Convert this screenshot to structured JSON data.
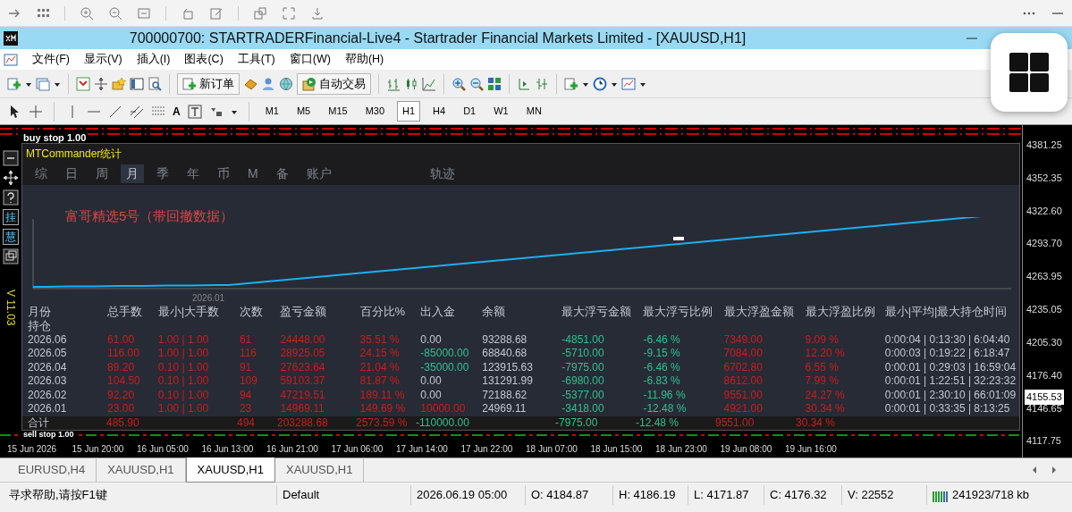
{
  "window": {
    "title": "700000700: STARTRADERFinancial-Live4 - Startrader Financial Markets Limited - [XAUUSD,H1]"
  },
  "menu": [
    "文件(F)",
    "显示(V)",
    "插入(I)",
    "图表(C)",
    "工具(T)",
    "窗口(W)",
    "帮助(H)"
  ],
  "toolbar": {
    "new_order": "新订单",
    "auto_trading": "自动交易"
  },
  "drawing_tools": {
    "text_tool": "A"
  },
  "timeframes": [
    {
      "label": "M1",
      "selected": false
    },
    {
      "label": "M5",
      "selected": false
    },
    {
      "label": "M15",
      "selected": false
    },
    {
      "label": "M30",
      "selected": false
    },
    {
      "label": "H1",
      "selected": true
    },
    {
      "label": "H4",
      "selected": false
    },
    {
      "label": "D1",
      "selected": false
    },
    {
      "label": "W1",
      "selected": false
    },
    {
      "label": "MN",
      "selected": false
    }
  ],
  "chart": {
    "top_order": "buy stop 1.00",
    "bottom_order": "sell stop 1.00",
    "version": "V 11.03",
    "side_buttons": [
      "挂",
      "慧"
    ],
    "price_axis": [
      "4381.25",
      "4352.35",
      "4322.60",
      "4293.70",
      "4263.95",
      "4235.05",
      "4205.30",
      "4176.40",
      "4146.65",
      "4117.75"
    ],
    "current_price": "4155.53",
    "time_axis": [
      "15 Jun 2026",
      "15 Jun 20:00",
      "16 Jun 05:00",
      "16 Jun 13:00",
      "16 Jun 21:00",
      "17 Jun 06:00",
      "17 Jun 14:00",
      "17 Jun 22:00",
      "18 Jun 07:00",
      "18 Jun 15:00",
      "18 Jun 23:00",
      "19 Jun 08:00",
      "19 Jun 16:00"
    ]
  },
  "panel": {
    "title": "MTCommander统计",
    "tabs": [
      {
        "label": "综",
        "selected": false
      },
      {
        "label": "日",
        "selected": false
      },
      {
        "label": "周",
        "selected": false
      },
      {
        "label": "月",
        "selected": true
      },
      {
        "label": "季",
        "selected": false
      },
      {
        "label": "年",
        "selected": false
      },
      {
        "label": "币",
        "selected": false
      },
      {
        "label": "M",
        "selected": false
      },
      {
        "label": "备",
        "selected": false
      },
      {
        "label": "账户",
        "selected": false
      },
      {
        "label": "轨迹",
        "selected": false
      }
    ],
    "curve_label": "富哥精选5号（带回撤数据）",
    "curve_date": "2026.01",
    "columns": [
      {
        "label": "月份",
        "sublabel": "持仓",
        "color": "#c3c8d1"
      },
      {
        "label": "总手数",
        "color": "#d11b1b"
      },
      {
        "label": "最小|大手数",
        "color": "#d11b1b"
      },
      {
        "label": "次数",
        "color": "#d11b1b"
      },
      {
        "label": "盈亏金额",
        "color": "#d11b1b"
      },
      {
        "label": "百分比%",
        "color": "#d11b1b"
      },
      {
        "label": "出入金"
      },
      {
        "label": "余额",
        "color": "#c3c8d1"
      },
      {
        "label": "最大浮亏金额",
        "color": "#2fc08f"
      },
      {
        "label": "最大浮亏比例",
        "color": "#2fc08f"
      },
      {
        "label": "最大浮盈金额",
        "color": "#d11b1b"
      },
      {
        "label": "最大浮盈比例",
        "color": "#d11b1b"
      },
      {
        "label": "最小|平均|最大持仓时间",
        "color": "#c3c8d1"
      }
    ],
    "rows": [
      {
        "cells": [
          "2026.06",
          "61.00",
          "1.00 | 1.00",
          "61",
          "24448.00",
          "35.51 %",
          {
            "text": "0.00",
            "color": "#c3c8d1"
          },
          "93288.68",
          "-4851.00",
          "-6.46 %",
          "7349.00",
          "9.09 %",
          "0:00:04 | 0:13:30 | 6:04:40"
        ]
      },
      {
        "cells": [
          "2026.05",
          "116.00",
          "1.00 | 1.00",
          "116",
          "28925.05",
          "24.15 %",
          {
            "text": "-85000.00",
            "color": "#2fc08f"
          },
          "68840.68",
          "-5710.00",
          "-9.15 %",
          "7084.00",
          "12.20 %",
          "0:00:03 | 0:19:22 | 6:18:47"
        ]
      },
      {
        "cells": [
          "2026.04",
          "89.20",
          "0.10 | 1.00",
          "91",
          "27623.64",
          "21.04 %",
          {
            "text": "-35000.00",
            "color": "#2fc08f"
          },
          "123915.63",
          "-7975.00",
          "-6.46 %",
          "6702.80",
          "6.55 %",
          "0:00:01 | 0:29:03 | 16:59:04"
        ]
      },
      {
        "cells": [
          "2026.03",
          "104.50",
          "0.10 | 1.00",
          "109",
          "59103.37",
          "81.87 %",
          {
            "text": "0.00",
            "color": "#c3c8d1"
          },
          "131291.99",
          "-6980.00",
          "-6.83 %",
          "8612.00",
          "7.99 %",
          "0:00:01 | 1:22:51 | 32:23:32"
        ]
      },
      {
        "cells": [
          "2026.02",
          "92.20",
          "0.10 | 1.00",
          "94",
          "47219.51",
          "189.11 %",
          {
            "text": "0.00",
            "color": "#c3c8d1"
          },
          "72188.62",
          "-5377.00",
          "-11.96 %",
          "9551.00",
          "24.27 %",
          "0:00:01 | 2:30:10 | 66:01:09"
        ]
      },
      {
        "cells": [
          "2026.01",
          "23.00",
          "1.00 | 1.00",
          "23",
          "14969.11",
          "149.69 %",
          {
            "text": "10000.00",
            "color": "#d11b1b"
          },
          "24969.11",
          "-3418.00",
          "-12.48 %",
          "4921.00",
          "30.34 %",
          "0:00:01 | 0:33:35 | 8:13:25"
        ]
      }
    ],
    "total": {
      "cells": [
        "合计",
        "485.90",
        null,
        "494",
        "203288.68",
        "2573.59 %",
        {
          "text": "-110000.00",
          "color": "#2fc08f"
        },
        null,
        "-7975.00",
        "-12.48 %",
        "9551.00",
        "30.34 %",
        null
      ]
    }
  },
  "chart_tabs": [
    {
      "label": "EURUSD,H4",
      "selected": false
    },
    {
      "label": "XAUUSD,H1",
      "selected": false
    },
    {
      "label": "XAUUSD,H1",
      "selected": true
    },
    {
      "label": "XAUUSD,H1",
      "selected": false
    }
  ],
  "status_bar": {
    "help": "寻求帮助,请按F1键",
    "profile": "Default",
    "time": "2026.06.19 05:00",
    "open": "O: 4184.87",
    "high": "H: 4186.19",
    "low": "L: 4171.87",
    "close": "C: 4176.32",
    "volume": "V: 22552",
    "traffic": "241923/718 kb"
  }
}
